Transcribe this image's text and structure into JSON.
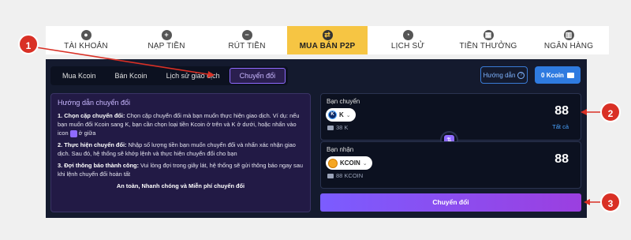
{
  "nav": [
    {
      "label": "TÀI KHOẢN",
      "icon": "user-icon",
      "glyph": "●"
    },
    {
      "label": "NẠP TIỀN",
      "icon": "plus-circle-icon",
      "glyph": "+"
    },
    {
      "label": "RÚT TIỀN",
      "icon": "minus-circle-icon",
      "glyph": "−"
    },
    {
      "label": "MUA BÁN P2P",
      "icon": "exchange-icon",
      "glyph": "⇄"
    },
    {
      "label": "LỊCH SỬ",
      "icon": "clock-icon",
      "glyph": "◔"
    },
    {
      "label": "TIỀN THƯỞNG",
      "icon": "gift-icon",
      "glyph": "▦"
    },
    {
      "label": "NGÂN HÀNG",
      "icon": "bank-icon",
      "glyph": "▥"
    }
  ],
  "tabs": [
    "Mua Kcoin",
    "Bán Kcoin",
    "Lịch sử giao dịch",
    "Chuyển đổi"
  ],
  "guide_button": "Hướng dẫn",
  "kcoin_button": "0 Kcoin",
  "guide": {
    "title": "Hướng dẫn chuyển đổi",
    "step1_bold": "1.  Chọn cặp chuyển đổi:",
    "step1_text": " Chọn cặp chuyển đổi mà bạn muốn thực hiện giao dịch. Ví dụ: nếu bạn muốn đổi Kcoin sang K, bạn cần chọn loại tiền Kcoin ở trên và K ở dưới, hoặc nhấn vào icon",
    "step1_tail": " ở giữa",
    "step2_bold": "2.  Thực hiện chuyển đổi:",
    "step2_text": " Nhập số lượng tiền bạn muốn chuyển đổi và nhấn xác nhận giao dịch. Sau đó, hệ thống sẽ khớp lệnh và thực hiện chuyển đổi cho bạn",
    "step3_bold": "3.  Đợi thông báo thành công:",
    "step3_text": " Vui lòng đợi trong giây lát, hệ thống sẽ gửi thông báo ngay sau khi lệnh chuyển đổi hoàn tất",
    "footer": "An toàn, Nhanh chóng và Miễn phí chuyển đổi"
  },
  "from": {
    "label": "Bạn chuyển",
    "coin": "K",
    "coin_badge": "K",
    "amount": "88",
    "balance": "38 K",
    "all": "Tất cả"
  },
  "to": {
    "label": "Bạn nhận",
    "coin": "KCOIN",
    "amount": "88",
    "balance": "88 KCOIN"
  },
  "swap_glyph": "⇅",
  "convert_button": "Chuyển đổi",
  "badges": [
    "1",
    "2",
    "3"
  ]
}
